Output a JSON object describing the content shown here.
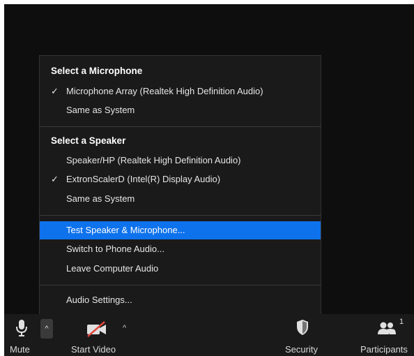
{
  "audio_menu": {
    "microphone_header": "Select a Microphone",
    "microphones": [
      {
        "label": "Microphone Array (Realtek High Definition Audio)",
        "checked": true
      },
      {
        "label": "Same as System",
        "checked": false
      }
    ],
    "speaker_header": "Select a Speaker",
    "speakers": [
      {
        "label": "Speaker/HP (Realtek High Definition Audio)",
        "checked": false
      },
      {
        "label": "ExtronScalerD (Intel(R) Display Audio)",
        "checked": true
      },
      {
        "label": "Same as System",
        "checked": false
      }
    ],
    "actions": [
      {
        "label": "Test Speaker & Microphone...",
        "highlighted": true
      },
      {
        "label": "Switch to Phone Audio...",
        "highlighted": false
      },
      {
        "label": "Leave Computer Audio",
        "highlighted": false
      }
    ],
    "settings_label": "Audio Settings...",
    "check_glyph": "✓",
    "highlight_color": "#0e72ed"
  },
  "toolbar": {
    "mute_label": "Mute",
    "video_label": "Start Video",
    "security_label": "Security",
    "participants_label": "Participants",
    "participants_count": "1",
    "caret_glyph": "^",
    "icons": [
      "microphone-icon",
      "video-off-icon",
      "shield-icon",
      "participants-icon"
    ]
  }
}
